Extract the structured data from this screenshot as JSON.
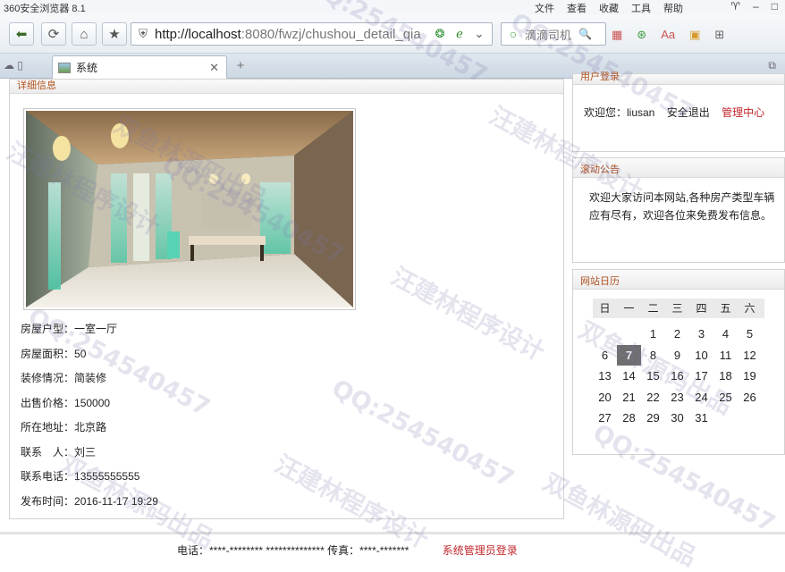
{
  "browser": {
    "title": "360安全浏览器 8.1",
    "menus": [
      "文件",
      "查看",
      "收藏",
      "工具",
      "帮助"
    ],
    "url_host": "http://localhost",
    "url_rest": ":8080/fwzj/chushou_detail_qia",
    "search_placeholder": "滴滴司机",
    "tab_label": "系统"
  },
  "main": {
    "section_title": "详细信息",
    "details": [
      {
        "label": "房屋户型：",
        "value": "一室一厅"
      },
      {
        "label": "房屋面积：",
        "value": "50"
      },
      {
        "label": "装修情况：",
        "value": "简装修"
      },
      {
        "label": "出售价格：",
        "value": "150000"
      },
      {
        "label": "所在地址：",
        "value": "北京路"
      },
      {
        "label": "联系　人：",
        "value": "刘三"
      },
      {
        "label": "联系电话：",
        "value": "13555555555"
      },
      {
        "label": "发布时间：",
        "value": "2016-11-17 19:29"
      }
    ]
  },
  "sidebar": {
    "login_title": "用户登录",
    "welcome": "欢迎您：liusan",
    "logout": "安全退出",
    "manage": "管理中心",
    "notice_title": "滚动公告",
    "notice_text": "欢迎大家访问本网站,各种房产类型车辆应有尽有，欢迎各位来免费发布信息。",
    "calendar_title": "网站日历",
    "weekdays": [
      "日",
      "一",
      "二",
      "三",
      "四",
      "五",
      "六"
    ],
    "days": [
      "",
      "",
      "1",
      "2",
      "3",
      "4",
      "5",
      "6",
      "7",
      "8",
      "9",
      "10",
      "11",
      "12",
      "13",
      "14",
      "15",
      "16",
      "17",
      "18",
      "19",
      "20",
      "21",
      "22",
      "23",
      "24",
      "25",
      "26",
      "27",
      "28",
      "29",
      "30",
      "31"
    ],
    "today": "7"
  },
  "footer": {
    "text": "电话：****-******** ************** 传真：****-*******",
    "admin_link": "系统管理员登录"
  },
  "watermarks": [
    "汪建林程序设计",
    "QQ:254540457",
    "双鱼林源码出品"
  ]
}
